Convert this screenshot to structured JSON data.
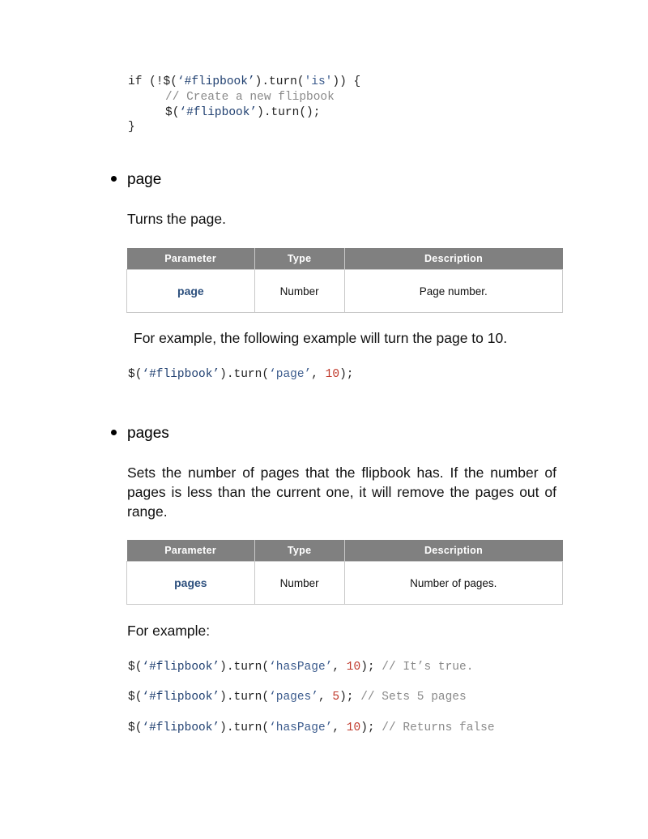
{
  "top_code": {
    "line1": {
      "kw": "if (!$(",
      "sel": "‘#flipbook’",
      "mid": ").turn(",
      "str": "'is'",
      "end": ")) {"
    },
    "line2": "// Create a new flipbook",
    "line3": {
      "pre": "$(",
      "sel": "‘#flipbook’",
      "end": ").turn();"
    },
    "line4": "}"
  },
  "section_page": {
    "title": "page",
    "description": "Turns the page.",
    "table": {
      "headers": [
        "Parameter",
        "Type",
        "Description"
      ],
      "row": {
        "parameter": "page",
        "type": "Number",
        "description": "Page number."
      }
    },
    "example_text": "For example, the following example will turn the page to 10.",
    "example_code": {
      "pre": "$(",
      "sel": "‘#flipbook’",
      "mid": ").turn(",
      "str": "‘page’",
      "sep": ", ",
      "num": "10",
      "end": ");"
    }
  },
  "section_pages": {
    "title": "pages",
    "description": "Sets the number of pages that the flipbook has. If the number of pages is less than the current one, it will remove the pages out of range.",
    "table": {
      "headers": [
        "Parameter",
        "Type",
        "Description"
      ],
      "row": {
        "parameter": "pages",
        "type": "Number",
        "description": "Number of pages."
      }
    },
    "example_text": "For example:",
    "examples": [
      {
        "pre": "$(",
        "sel": "‘#flipbook’",
        "mid": ").turn(",
        "str": "‘hasPage’",
        "sep": ", ",
        "num": "10",
        "end": "); ",
        "cmt": "// It’s true."
      },
      {
        "pre": "$(",
        "sel": "‘#flipbook’",
        "mid": ").turn(",
        "str": "‘pages’",
        "sep": ", ",
        "num": "5",
        "end": "); ",
        "cmt": "// Sets 5 pages"
      },
      {
        "pre": "$(",
        "sel": "‘#flipbook’",
        "mid": ").turn(",
        "str": "‘hasPage’",
        "sep": ", ",
        "num": "10",
        "end": "); ",
        "cmt": "// Returns false"
      }
    ]
  }
}
